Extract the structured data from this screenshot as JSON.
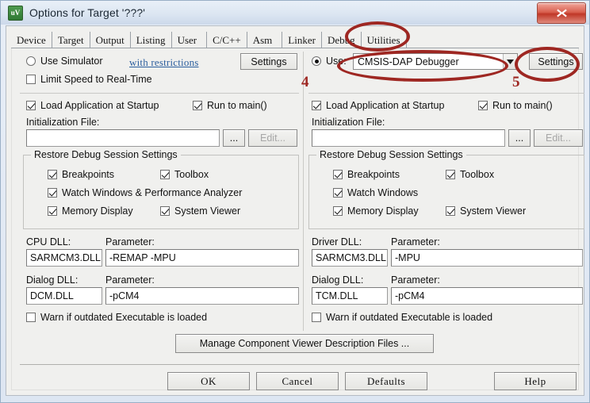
{
  "window": {
    "title": "Options for Target '???'",
    "app_icon": "keil-uvision-icon",
    "close_label": "x"
  },
  "tabs": [
    {
      "label": "Device",
      "selected": false
    },
    {
      "label": "Target",
      "selected": false
    },
    {
      "label": "Output",
      "selected": false
    },
    {
      "label": "Listing",
      "selected": false
    },
    {
      "label": "User",
      "selected": false
    },
    {
      "label": "C/C++",
      "selected": false
    },
    {
      "label": "Asm",
      "selected": false
    },
    {
      "label": "Linker",
      "selected": false
    },
    {
      "label": "Debug",
      "selected": true
    },
    {
      "label": "Utilities",
      "selected": false
    }
  ],
  "left": {
    "radio_label": "Use Simulator",
    "radio_selected": false,
    "restrictions_link": "with restrictions",
    "settings_button": "Settings",
    "limit_speed_label": "Limit Speed to Real-Time",
    "limit_speed_checked": false,
    "load_app_label": "Load Application at Startup",
    "load_app_checked": true,
    "run_to_main_label": "Run to main()",
    "run_to_main_checked": true,
    "init_file_label": "Initialization File:",
    "init_file_value": "",
    "browse_button": "...",
    "edit_button": "Edit...",
    "restore_group": "Restore Debug Session Settings",
    "restore_items": [
      {
        "label": "Breakpoints",
        "checked": true
      },
      {
        "label": "Toolbox",
        "checked": true
      },
      {
        "label": "Watch Windows & Performance Analyzer",
        "checked": true
      },
      {
        "label": "Memory Display",
        "checked": true
      },
      {
        "label": "System Viewer",
        "checked": true
      }
    ],
    "dll_label": "CPU DLL:",
    "dll_value": "SARMCM3.DLL",
    "dll_param_label": "Parameter:",
    "dll_param_value": "-REMAP -MPU",
    "dialog_dll_label": "Dialog DLL:",
    "dialog_dll_value": "DCM.DLL",
    "dialog_param_label": "Parameter:",
    "dialog_param_value": "-pCM4",
    "warn_label": "Warn if outdated Executable is loaded",
    "warn_checked": false
  },
  "right": {
    "radio_label": "Use:",
    "radio_selected": true,
    "debugger_value": "CMSIS-DAP Debugger",
    "settings_button": "Settings",
    "load_app_label": "Load Application at Startup",
    "load_app_checked": true,
    "run_to_main_label": "Run to main()",
    "run_to_main_checked": true,
    "init_file_label": "Initialization File:",
    "init_file_value": "",
    "browse_button": "...",
    "edit_button": "Edit...",
    "restore_group": "Restore Debug Session Settings",
    "restore_items": [
      {
        "label": "Breakpoints",
        "checked": true
      },
      {
        "label": "Toolbox",
        "checked": true
      },
      {
        "label": "Watch Windows",
        "checked": true
      },
      {
        "label": "Memory Display",
        "checked": true
      },
      {
        "label": "System Viewer",
        "checked": true
      }
    ],
    "dll_label": "Driver DLL:",
    "dll_value": "SARMCM3.DLL",
    "dll_param_label": "Parameter:",
    "dll_param_value": "-MPU",
    "dialog_dll_label": "Dialog DLL:",
    "dialog_dll_value": "TCM.DLL",
    "dialog_param_label": "Parameter:",
    "dialog_param_value": "-pCM4",
    "warn_label": "Warn if outdated Executable is loaded",
    "warn_checked": false
  },
  "manage_button": "Manage Component Viewer Description Files ...",
  "footer": {
    "ok": "OK",
    "cancel": "Cancel",
    "defaults": "Defaults",
    "help": "Help"
  },
  "annotations": {
    "color": "#9e2722",
    "num_debugger": "4",
    "num_settings": "5"
  }
}
